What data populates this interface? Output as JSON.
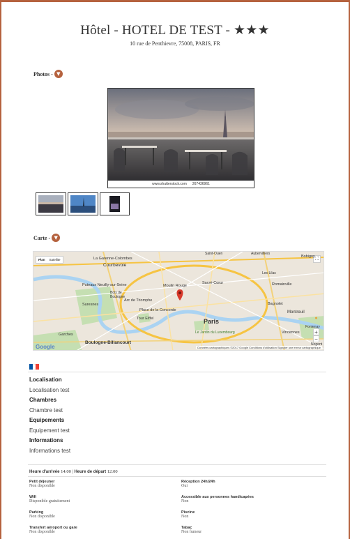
{
  "hotel": {
    "title": "Hôtel - HOTEL DE TEST - ★★★",
    "address": "10 rue de Penthievre, 75008, PARIS, FR"
  },
  "photos": {
    "label": "Photos -",
    "watermark_site": "www.shutterstock.com",
    "watermark_id": "267436961",
    "thumbnails_count": 3
  },
  "map": {
    "label": "Carte -",
    "type_options": [
      "Plan",
      "Satellite"
    ],
    "selected_type": "Plan",
    "attribution": "Données cartographiques ©2017 Google   Conditions d'utilisation   Signaler une erreur cartographique",
    "zoom_in": "+",
    "zoom_out": "−",
    "brand": "Google",
    "places": {
      "la_garenne": "La Garenne-Colombes",
      "courbevoie": "Courbevoie",
      "neuilly": "Puteaux Neuilly-sur-Seine",
      "arc": "Arc de Triomphe",
      "moulin": "Moulin Rouge",
      "sacre": "Sacré-Cœur",
      "suresnes": "Suresnes",
      "bois": "Bois de Boulogne",
      "concorde": "Place de la Concorde",
      "eiffel": "Tour Eiffel",
      "paris": "Paris",
      "garches": "Garches",
      "boulogne": "Boulogne-Billancourt",
      "romainville": "Romainville",
      "bagnolet": "Bagnolet",
      "montreuil": "Montreuil",
      "vincennes": "Vincennes",
      "luxembourg": "Le Jardin du Luxembourg",
      "bobigny": "Bobigny",
      "saint_ouen": "Saint-Ouen",
      "aubervilliers": "Aubervilliers",
      "lilas": "Les Lilas",
      "fontenay": "Fontenay",
      "nogent": "Nogent"
    }
  },
  "info": {
    "localisation_title": "Localisation",
    "localisation_value": "Localisation test",
    "chambres_title": "Chambres",
    "chambres_value": "Chambre test",
    "equipements_title": "Equipements",
    "equipements_value": "Equipement test",
    "informations_title": "Informations",
    "informations_value": "Informations test"
  },
  "times": {
    "arrival_label": "Heure d'arrivée",
    "arrival_value": "14:00",
    "departure_label": "Heure de départ",
    "departure_value": "12:00"
  },
  "amenities": [
    {
      "key": "Petit déjeuner",
      "value": "Non disponible"
    },
    {
      "key": "Réception 24h/24h",
      "value": "Oui"
    },
    {
      "key": "Wifi",
      "value": "Disponible gratuitement"
    },
    {
      "key": "Accessible aux personnes handicapées",
      "value": "Non"
    },
    {
      "key": "Parking",
      "value": "Non disponible"
    },
    {
      "key": "Piscine",
      "value": "Non"
    },
    {
      "key": "Transfert aéroport ou gare",
      "value": "Non disponible"
    },
    {
      "key": "Tabac",
      "value": "Non fumeur"
    }
  ],
  "colors": {
    "accent": "#b5623e",
    "flag_blue": "#0055a4",
    "flag_white": "#ffffff",
    "flag_red": "#ef4135"
  },
  "icons": {
    "section_toggle": "chevron-down-icon",
    "map_marker": "map-pin-icon",
    "fullscreen": "fullscreen-icon",
    "pegman": "street-view-icon"
  }
}
